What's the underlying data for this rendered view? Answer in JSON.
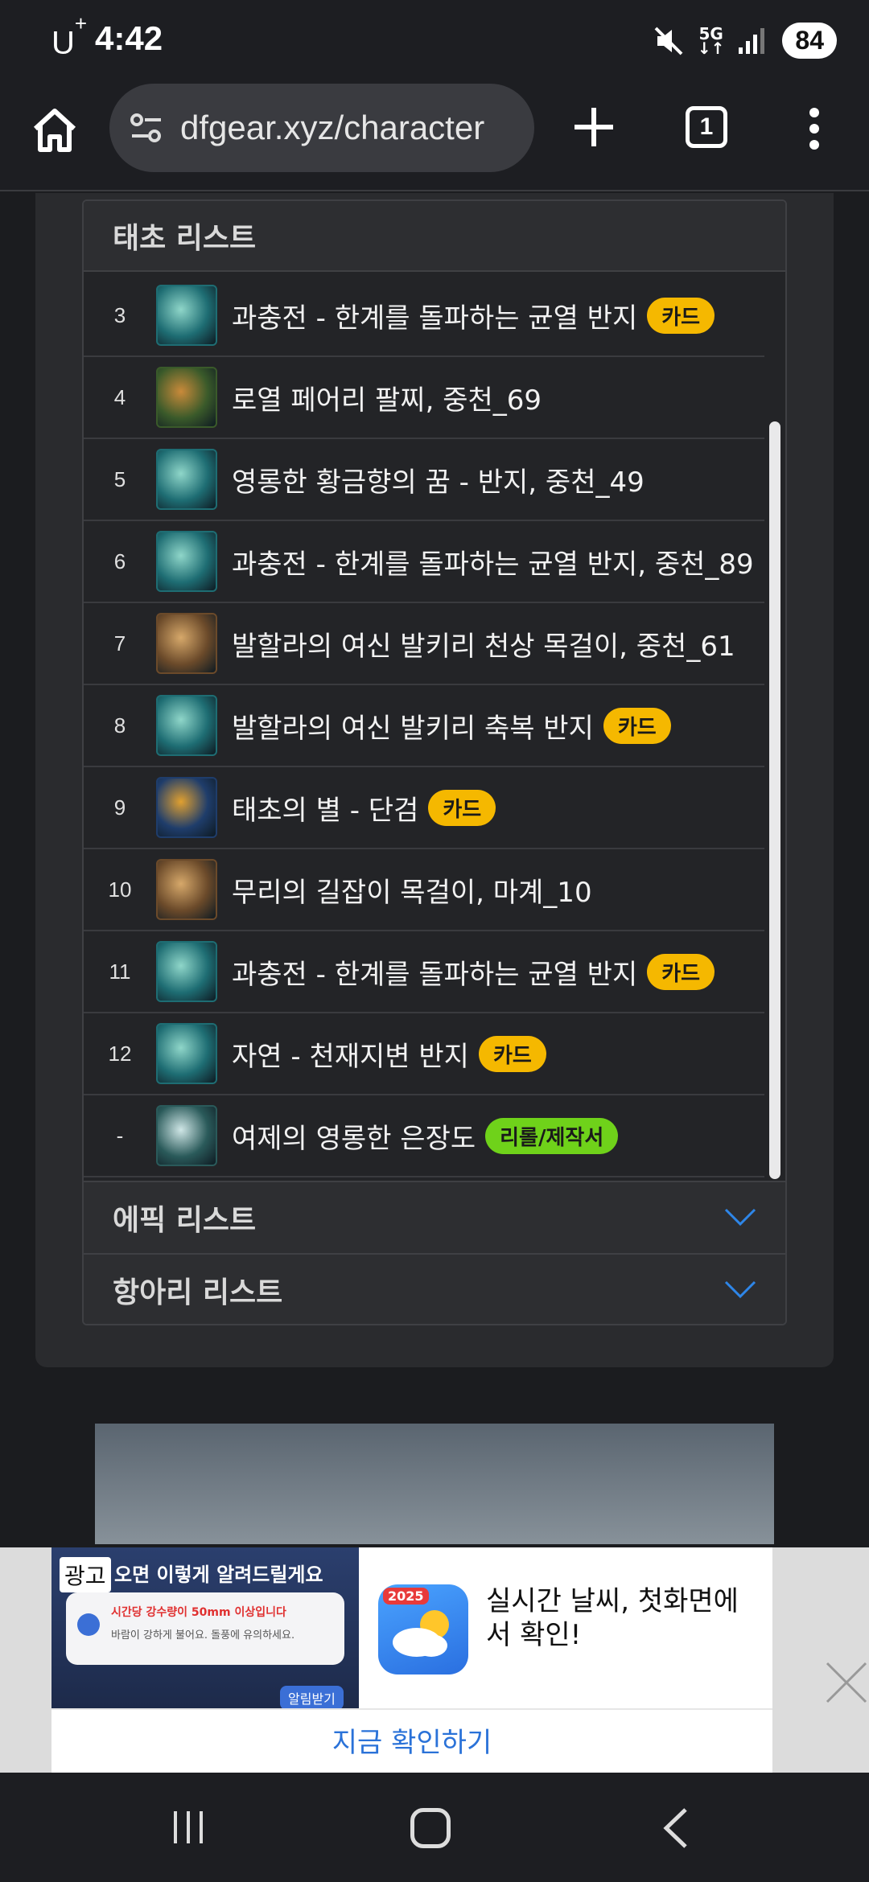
{
  "status": {
    "carrier": "U",
    "carrier_sup": "+",
    "time": "4:42",
    "network": "5G",
    "battery": "84"
  },
  "browser": {
    "url": "dfgear.xyz/character",
    "tab_count": "1"
  },
  "panel": {
    "title": "태초 리스트",
    "items": [
      {
        "num": "3",
        "name": "과충전 - 한계를 돌파하는 균열 반지",
        "badge": "카드",
        "badge_type": "card",
        "icon": "ring-icon"
      },
      {
        "num": "4",
        "name": "로열 페어리 팔찌, 중천_69",
        "badge": "",
        "badge_type": "",
        "icon": "bracelet-icon"
      },
      {
        "num": "5",
        "name": "영롱한 황금향의 꿈 - 반지, 중천_49",
        "badge": "",
        "badge_type": "",
        "icon": "ring-icon"
      },
      {
        "num": "6",
        "name": "과충전 - 한계를 돌파하는 균열 반지, 중천_89",
        "badge": "",
        "badge_type": "",
        "icon": "ring-icon"
      },
      {
        "num": "7",
        "name": "발할라의 여신 발키리 천상 목걸이, 중천_61",
        "badge": "",
        "badge_type": "",
        "icon": "necklace-icon"
      },
      {
        "num": "8",
        "name": "발할라의 여신 발키리 축복 반지",
        "badge": "카드",
        "badge_type": "card",
        "icon": "ring-icon"
      },
      {
        "num": "9",
        "name": "태초의 별 - 단검",
        "badge": "카드",
        "badge_type": "card",
        "icon": "dagger-icon"
      },
      {
        "num": "10",
        "name": "무리의 길잡이 목걸이, 마계_10",
        "badge": "",
        "badge_type": "",
        "icon": "necklace-icon"
      },
      {
        "num": "11",
        "name": "과충전 - 한계를 돌파하는 균열 반지",
        "badge": "카드",
        "badge_type": "card",
        "icon": "ring-icon"
      },
      {
        "num": "12",
        "name": "자연 - 천재지변 반지",
        "badge": "카드",
        "badge_type": "card",
        "icon": "ring-icon"
      },
      {
        "num": "-",
        "name": "여제의 영롱한 은장도",
        "badge": "리롤/제작서",
        "badge_type": "green",
        "icon": "knife-icon"
      }
    ]
  },
  "sections": {
    "epic": "에픽 리스트",
    "jar": "항아리 리스트"
  },
  "ad": {
    "label": "광고",
    "visual_title": "오면 이렇게 알려드릴게요",
    "notice_line1": "시간당 강수량이 50mm 이상입니다",
    "notice_line2": "바람이 강하게 불어요. 돌풍에 유의하세요.",
    "notice_button": "알림받기",
    "app_year": "2025",
    "headline": "실시간 날씨, 첫화면에서 확인!",
    "cta": "지금 확인하기"
  },
  "colors": {
    "card_badge": "#f5b800",
    "green_badge": "#6fd21a",
    "cta": "#2a72d8"
  }
}
